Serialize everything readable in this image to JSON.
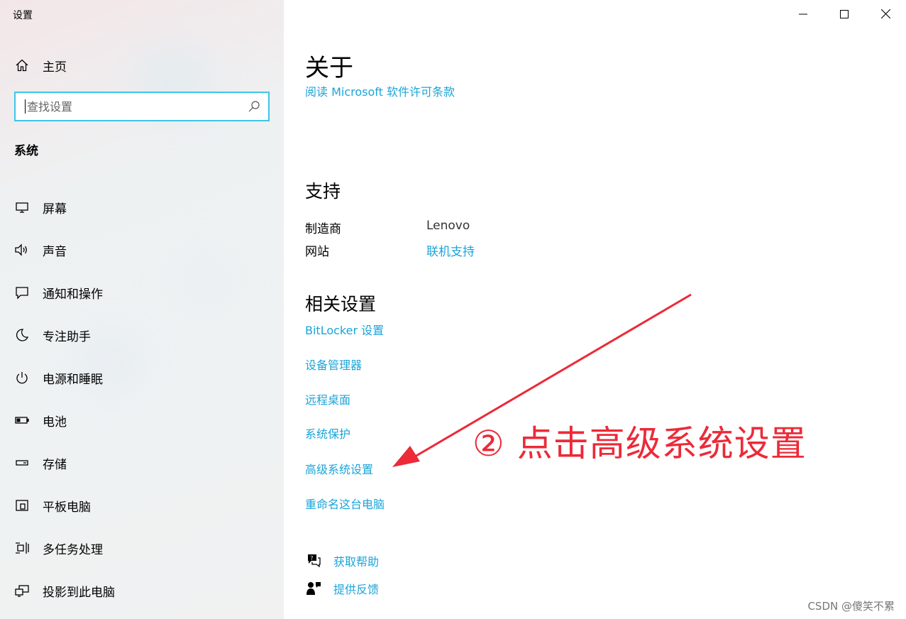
{
  "window": {
    "title": "设置"
  },
  "sidebar": {
    "home_label": "主页",
    "search_placeholder": "查找设置",
    "section_title": "系统",
    "items": [
      {
        "label": "屏幕",
        "icon": "monitor-icon"
      },
      {
        "label": "声音",
        "icon": "speaker-icon"
      },
      {
        "label": "通知和操作",
        "icon": "notification-icon"
      },
      {
        "label": "专注助手",
        "icon": "moon-icon"
      },
      {
        "label": "电源和睡眠",
        "icon": "power-icon"
      },
      {
        "label": "电池",
        "icon": "battery-icon"
      },
      {
        "label": "存储",
        "icon": "storage-icon"
      },
      {
        "label": "平板电脑",
        "icon": "tablet-icon"
      },
      {
        "label": "多任务处理",
        "icon": "multitask-icon"
      },
      {
        "label": "投影到此电脑",
        "icon": "project-icon"
      }
    ]
  },
  "main": {
    "about_title": "关于",
    "license_link": "阅读 Microsoft 软件许可条款",
    "support_title": "支持",
    "support_rows": [
      {
        "label": "制造商",
        "value": "Lenovo",
        "is_link": false
      },
      {
        "label": "网站",
        "value": "联机支持",
        "is_link": true
      }
    ],
    "related_title": "相关设置",
    "related_links": [
      "BitLocker 设置",
      "设备管理器",
      "远程桌面",
      "系统保护",
      "高级系统设置",
      "重命名这台电脑"
    ],
    "help_links": [
      {
        "label": "获取帮助",
        "icon": "help-chat-icon"
      },
      {
        "label": "提供反馈",
        "icon": "feedback-icon"
      }
    ]
  },
  "annotation": {
    "text": "② 点击高级系统设置",
    "color": "#ec2a38"
  },
  "watermark": "CSDN @傻笑不累",
  "colors": {
    "accent": "#1ba4d9",
    "search_border": "#3cc6ea"
  }
}
